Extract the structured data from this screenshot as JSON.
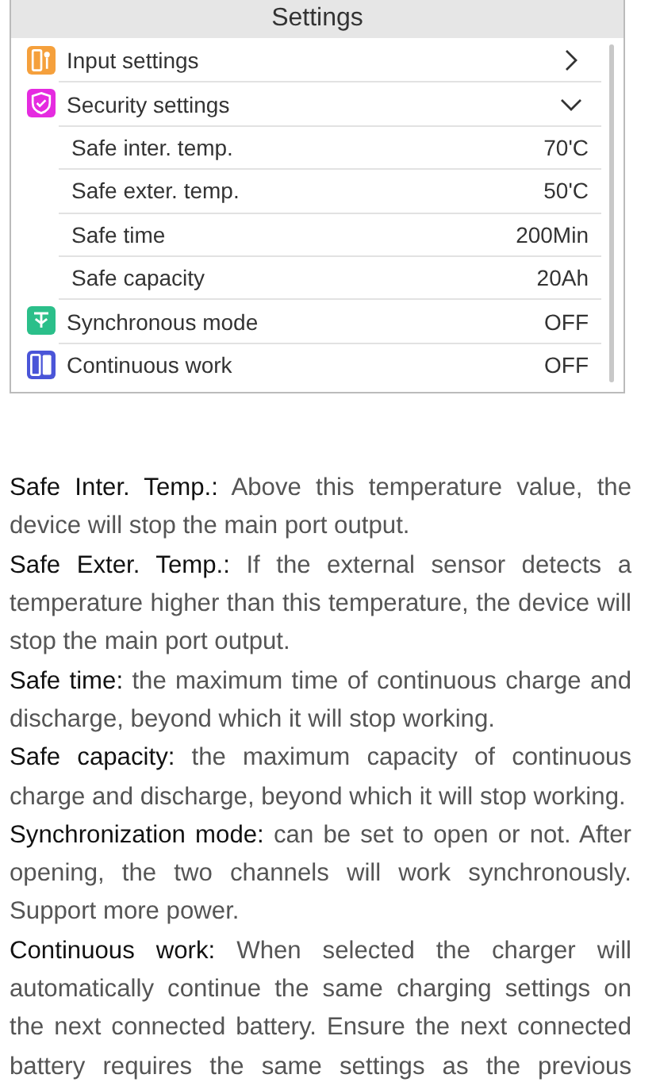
{
  "screen": {
    "title": "Settings",
    "rows": [
      {
        "label": "Input settings",
        "kind": "input",
        "expanded": false
      },
      {
        "label": "Security settings",
        "kind": "shield",
        "expanded": true,
        "children": [
          {
            "label": "Safe inter. temp.",
            "value": "70'C"
          },
          {
            "label": "Safe exter. temp.",
            "value": "50'C"
          },
          {
            "label": "Safe time",
            "value": "200Min"
          },
          {
            "label": "Safe capacity",
            "value": "20Ah"
          }
        ]
      },
      {
        "label": "Synchronous mode",
        "kind": "sync",
        "value": "OFF"
      },
      {
        "label": "Continuous work",
        "kind": "battery",
        "value": "OFF"
      }
    ]
  },
  "paragraphs": [
    "**Safe Inter. Temp.:** Above this temperature value, the device will stop the main port output.",
    "**Safe Exter. Temp.:** If the external sensor detects a temperature higher than this temperature, the device will stop the main port output.",
    "**Safe time:** the maximum time of continuous charge and discharge, beyond which it will stop working.",
    "**Safe capacity:** the maximum capacity of continuous charge and discharge, beyond which it will stop working.",
    "**Synchronization mode:** can be set to open or not. After opening, the two channels will work synchronously. Support more power.",
    "**Continuous work:** When selected the charger will automatically continue the same charging settings on the next connected battery. Ensure the next connected battery requires the same settings as the previous"
  ]
}
